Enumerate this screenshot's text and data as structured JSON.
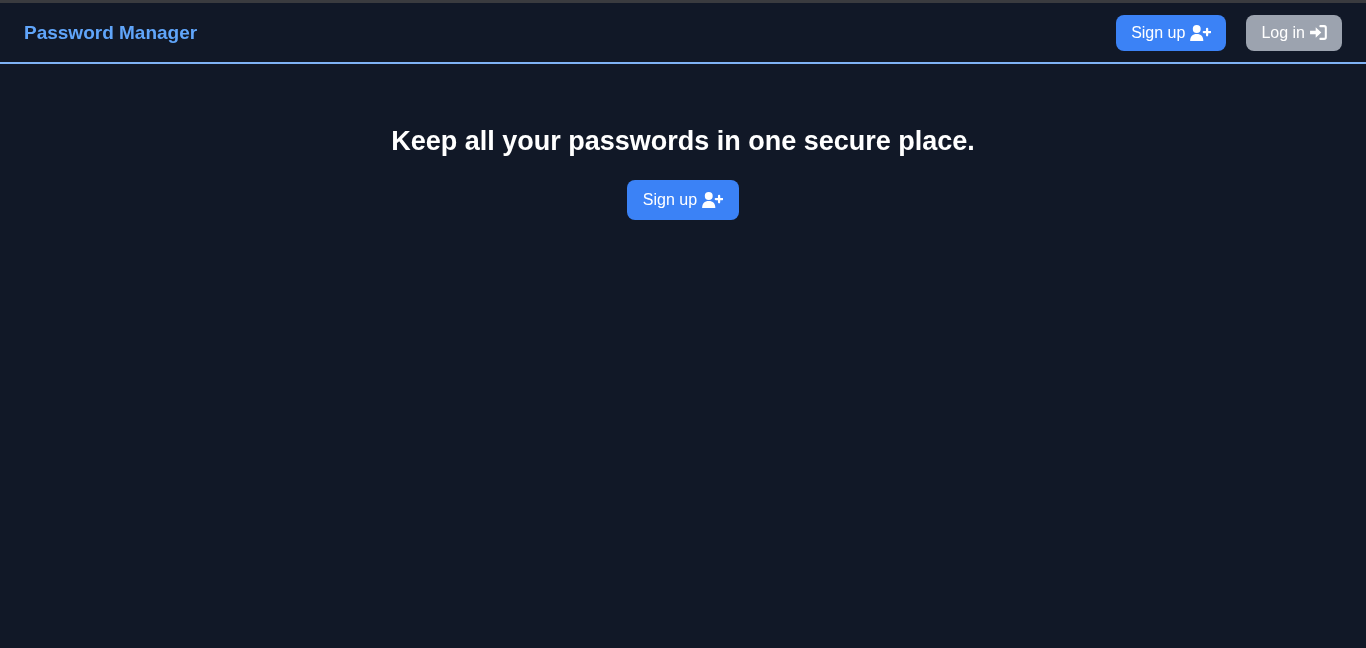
{
  "header": {
    "title": "Password Manager",
    "buttons": [
      {
        "label": "Sign up",
        "kind": "signup"
      },
      {
        "label": "Log in",
        "kind": "login"
      }
    ]
  },
  "hero": {
    "heading": "Keep all your passwords in one secure place.",
    "button": {
      "label": "Sign up",
      "kind": "signup"
    }
  }
}
